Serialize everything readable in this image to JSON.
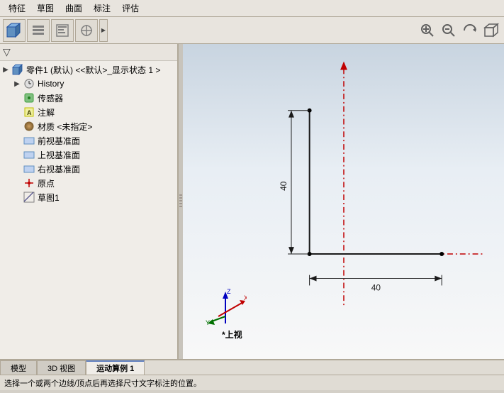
{
  "menu": {
    "items": [
      "特征",
      "草图",
      "曲面",
      "标注",
      "评估"
    ]
  },
  "toolbar": {
    "buttons": [
      {
        "name": "part-icon",
        "symbol": "📦"
      },
      {
        "name": "feature-tree-icon",
        "symbol": "☰"
      },
      {
        "name": "properties-icon",
        "symbol": "🗂"
      },
      {
        "name": "crosshair-icon",
        "symbol": "⊕"
      }
    ]
  },
  "top_right_tools": [
    {
      "name": "zoom-area-icon",
      "symbol": "🔍"
    },
    {
      "name": "zoom-fit-icon",
      "symbol": "🔎"
    },
    {
      "name": "rotate-icon",
      "symbol": "⟳"
    },
    {
      "name": "view-orient-icon",
      "symbol": "🧊"
    }
  ],
  "tree": {
    "root": {
      "label": "零件1 (默认) <<默认>_显示状态 1 >",
      "icon": "part"
    },
    "items": [
      {
        "id": "history",
        "label": "History",
        "icon": "history",
        "indent": 1,
        "expandable": true
      },
      {
        "id": "sensor",
        "label": "传感器",
        "icon": "sensor",
        "indent": 1,
        "expandable": false
      },
      {
        "id": "notes",
        "label": "注解",
        "icon": "note",
        "indent": 1,
        "expandable": false
      },
      {
        "id": "material",
        "label": "材质 <未指定>",
        "icon": "material",
        "indent": 1,
        "expandable": false
      },
      {
        "id": "front-plane",
        "label": "前视基准面",
        "icon": "plane",
        "indent": 1,
        "expandable": false
      },
      {
        "id": "top-plane",
        "label": "上视基准面",
        "icon": "plane",
        "indent": 1,
        "expandable": false
      },
      {
        "id": "right-plane",
        "label": "右视基准面",
        "icon": "plane",
        "indent": 1,
        "expandable": false
      },
      {
        "id": "origin",
        "label": "原点",
        "icon": "origin",
        "indent": 1,
        "expandable": false
      },
      {
        "id": "sketch1",
        "label": "草图1",
        "icon": "sketch",
        "indent": 1,
        "expandable": false
      }
    ]
  },
  "tabs": [
    {
      "label": "模型",
      "active": false
    },
    {
      "label": "3D 视图",
      "active": false
    },
    {
      "label": "运动算例 1",
      "active": true
    }
  ],
  "status": {
    "text": "选择一个或两个边线/顶点后再选择尺寸文字标注的位置。"
  },
  "sketch": {
    "dimension_vertical": "40",
    "dimension_horizontal": "40"
  },
  "view_label": "*上视"
}
